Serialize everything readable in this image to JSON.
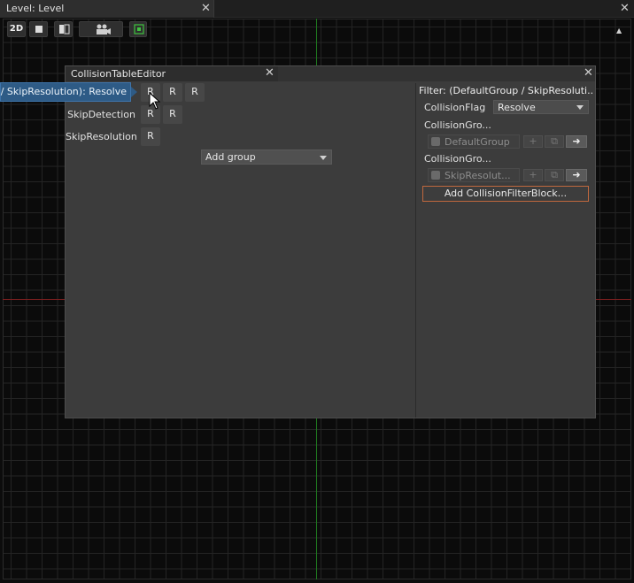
{
  "tab": {
    "title": "Level: Level"
  },
  "viewport_toolbar": {
    "mode_2d": "2D"
  },
  "editor": {
    "title": "CollisionTableEditor",
    "tooltip": "p / SkipResolution): Resolve",
    "rows": [
      {
        "label": "",
        "cells": [
          "R",
          "R",
          "R"
        ]
      },
      {
        "label": "SkipDetection",
        "cells": [
          "R",
          "R"
        ]
      },
      {
        "label": "SkipResolution",
        "cells": [
          "R"
        ]
      }
    ],
    "add_group": "Add group"
  },
  "filter_panel": {
    "title": "Filter: (DefaultGroup / SkipResoluti...",
    "flag_label": "CollisionFlag",
    "flag_value": "Resolve",
    "group1_label": "CollisionGro...",
    "group1_value": "DefaultGroup",
    "group2_label": "CollisionGro...",
    "group2_value": "SkipResolut...",
    "add_block": "Add CollisionFilterBlock..."
  },
  "colors": {
    "tooltip_bg": "#2e5b86",
    "accent_border": "#c0683e",
    "x_axis": "#7a1f1f",
    "y_axis": "#1f7a1f"
  }
}
